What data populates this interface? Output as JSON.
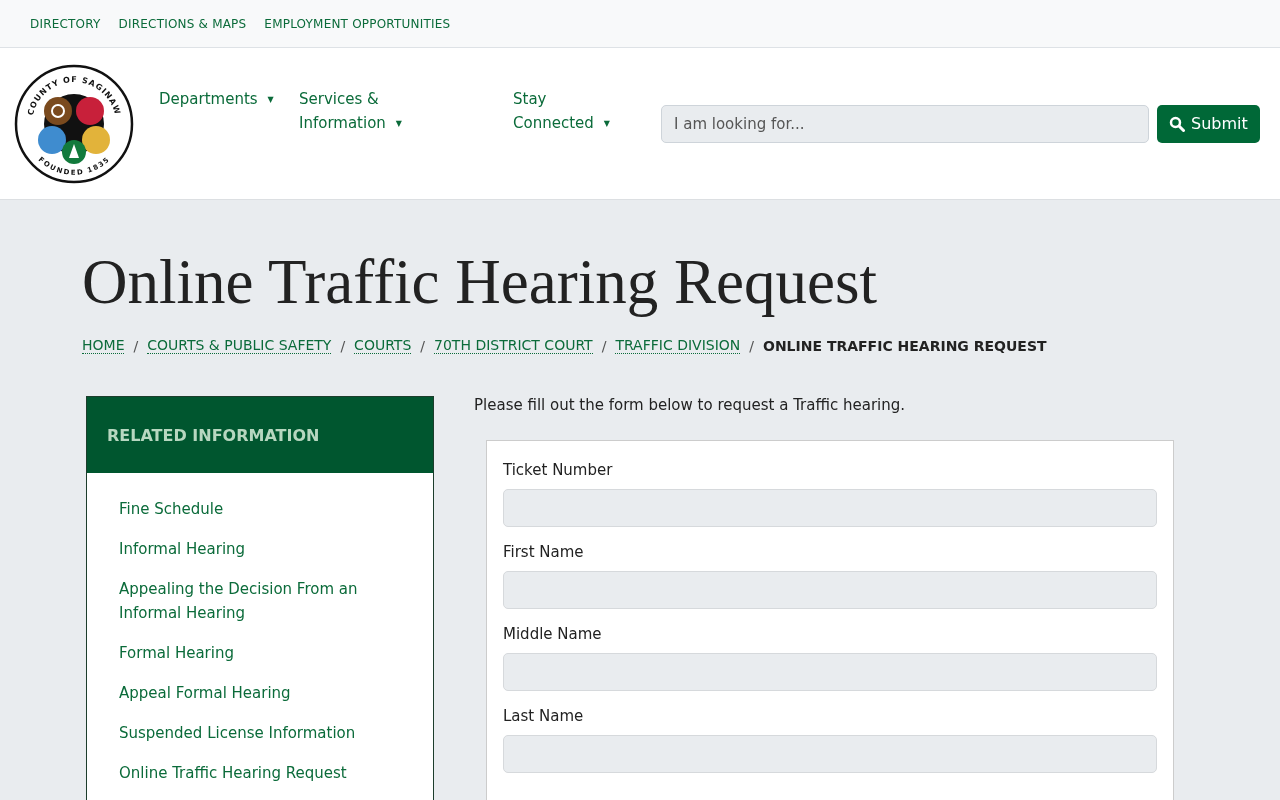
{
  "top_links": [
    "DIRECTORY",
    "DIRECTIONS & MAPS",
    "EMPLOYMENT OPPORTUNITIES"
  ],
  "logo": {
    "top_text": "COUNTY OF SAGINAW",
    "bottom_text": "FOUNDED 1835"
  },
  "nav": [
    {
      "label": "Departments",
      "caret": "▼"
    },
    {
      "label": "Services & Information",
      "caret": "▼"
    },
    {
      "label": "Stay Connected",
      "caret": "▼"
    }
  ],
  "search": {
    "placeholder": "I am looking for...",
    "button": "Submit"
  },
  "title": "Online Traffic Hearing Request",
  "breadcrumb_separator": "/",
  "breadcrumb": [
    {
      "label": "HOME",
      "current": false
    },
    {
      "label": "COURTS & PUBLIC SAFETY",
      "current": false
    },
    {
      "label": "COURTS",
      "current": false
    },
    {
      "label": "70TH DISTRICT COURT",
      "current": false
    },
    {
      "label": "TRAFFIC DIVISION",
      "current": false
    },
    {
      "label": "ONLINE TRAFFIC HEARING REQUEST",
      "current": true
    }
  ],
  "sidebar": {
    "heading": "RELATED INFORMATION",
    "items": [
      "Fine Schedule",
      "Informal Hearing",
      "Appealing the Decision From an Informal Hearing",
      "Formal Hearing",
      "Appeal Formal Hearing",
      "Suspended License Information",
      "Online Traffic Hearing Request"
    ]
  },
  "intro": "Please fill out the form below to request a Traffic hearing.",
  "form_fields": [
    {
      "label": "Ticket Number"
    },
    {
      "label": "First Name"
    },
    {
      "label": "Middle Name"
    },
    {
      "label": "Last Name"
    }
  ]
}
